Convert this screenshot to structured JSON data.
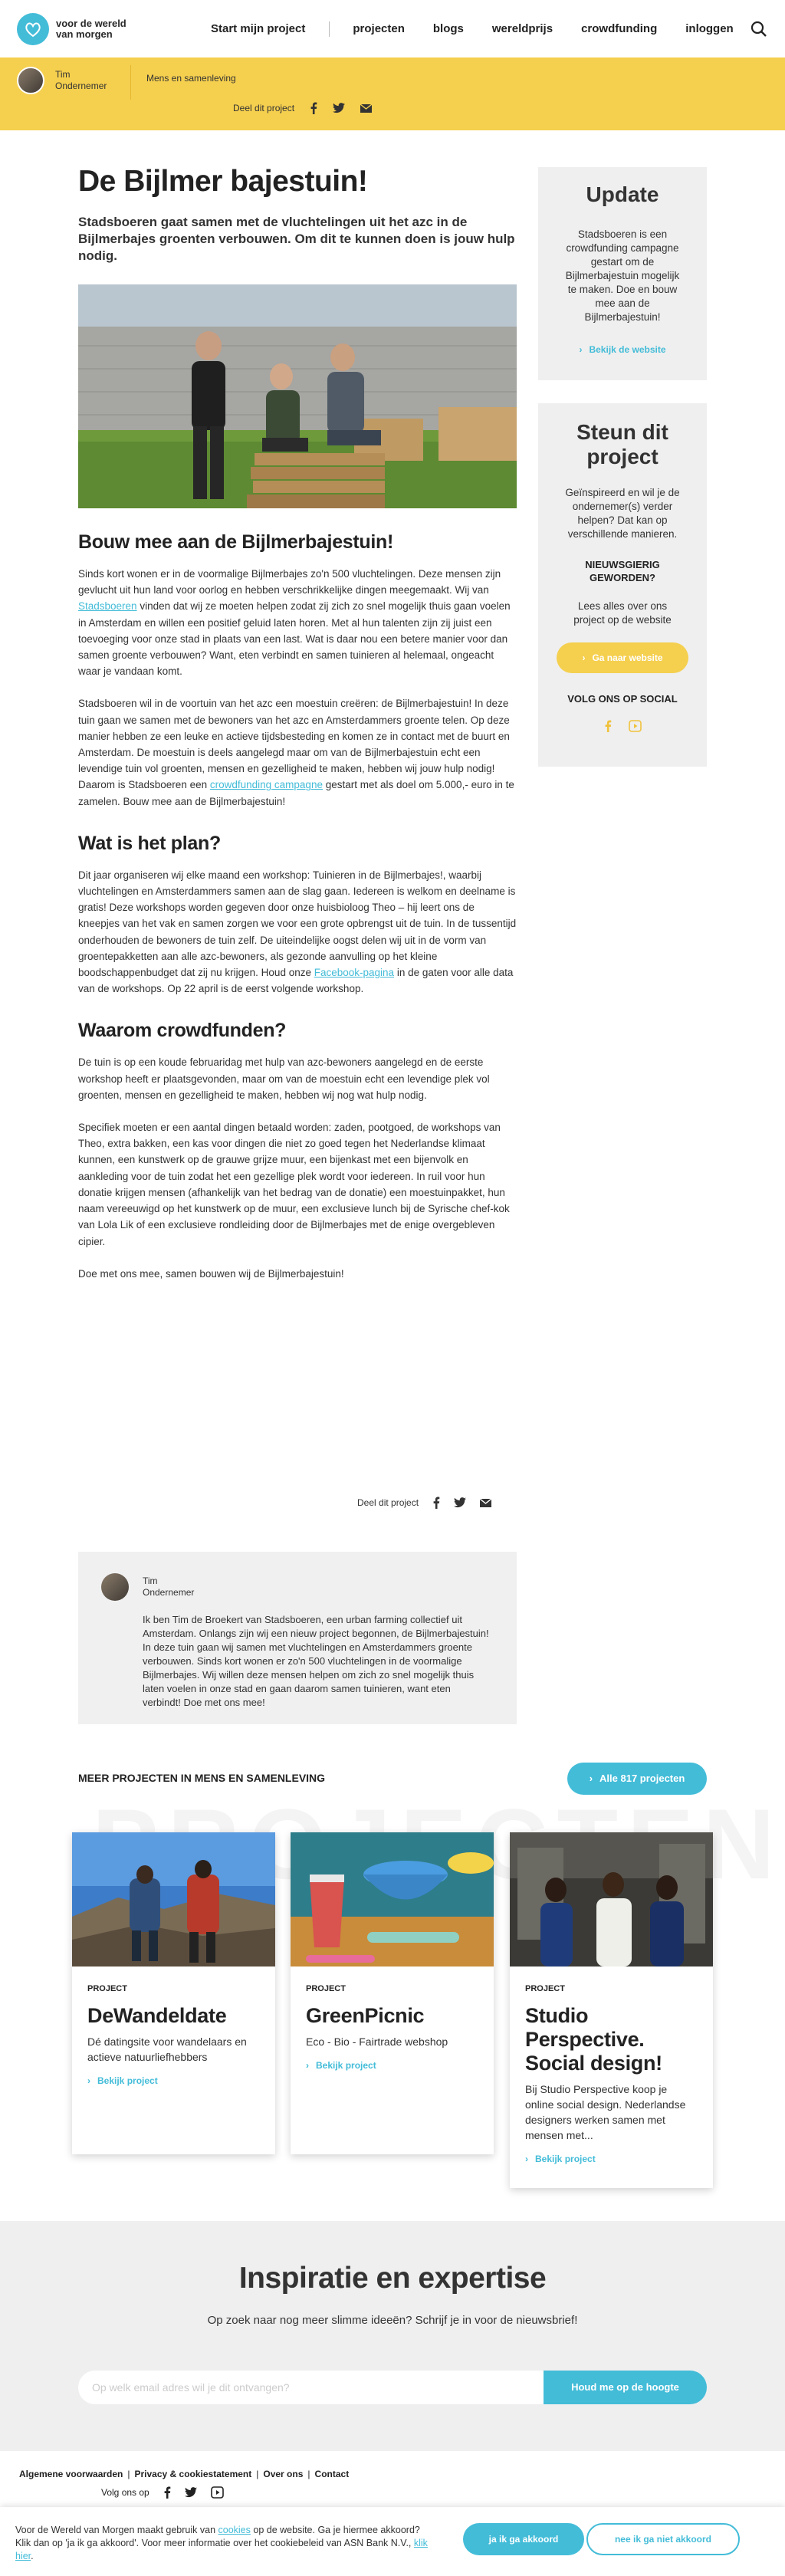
{
  "header": {
    "logo_text": "voor de wereld van morgen",
    "nav": [
      "Start mijn project",
      "projecten",
      "blogs",
      "wereldprijs",
      "crowdfunding",
      "inloggen"
    ]
  },
  "ybar": {
    "author_name": "Tim",
    "author_role": "Ondernemer",
    "category": "Mens en samenleving",
    "share_label": "Deel dit project"
  },
  "article": {
    "title": "De Bijlmer bajestuin!",
    "intro": "Stadsboeren gaat samen met de vluchtelingen uit het azc in de Bijlmerbajes groenten verbouwen. Om dit te kunnen doen is jouw hulp nodig.",
    "h_build": "Bouw mee aan de Bijlmerbajestuin!",
    "p1_a": "Sinds kort wonen er in de voormalige Bijlmerbajes zo'n 500 vluchtelingen. Deze mensen zijn gevlucht uit hun land voor oorlog en hebben verschrikkelijke dingen meegemaakt. Wij van ",
    "p1_link": "Stadsboeren",
    "p1_b": " vinden dat wij ze moeten helpen zodat zij zich zo snel mogelijk thuis gaan voelen in Amsterdam en willen een positief geluid laten horen. Met al hun talenten zijn zij juist een toevoeging voor onze stad in plaats van een last. Wat is daar nou een betere manier voor dan samen groente verbouwen? Want, eten verbindt en samen tuinieren al helemaal, ongeacht waar je vandaan komt.",
    "p2_a": "Stadsboeren wil in de voortuin van het azc een moestuin creëren: de Bijlmerbajestuin! In deze tuin gaan we samen met de bewoners van het azc en Amsterdammers groente telen. Op deze manier hebben ze een leuke en actieve tijdsbesteding en komen ze in contact met de buurt en Amsterdam. De moestuin is deels aangelegd maar om van de Bijlmerbajestuin echt een levendige tuin vol groenten, mensen en gezelligheid te maken, hebben wij jouw hulp nodig! Daarom is Stadsboeren een ",
    "p2_link": "crowdfunding campagne",
    "p2_b": " gestart met als doel om 5.000,- euro in te zamelen. Bouw mee aan de Bijlmerbajestuin!",
    "h_plan": "Wat is het plan?",
    "p3_a": "Dit jaar organiseren wij elke maand een workshop: Tuinieren in de Bijlmerbajes!, waarbij vluchtelingen en Amsterdammers samen aan de slag gaan. Iedereen is welkom en deelname is gratis! Deze workshops worden gegeven door onze huisbioloog Theo – hij leert ons de kneepjes van het vak en samen zorgen we voor een grote opbrengst uit de tuin. In de tussentijd onderhouden de bewoners de tuin zelf. De uiteindelijke oogst delen wij uit in de vorm van groentepakketten aan alle azc-bewoners, als gezonde aanvulling op het kleine boodschappenbudget dat zij nu krijgen. Houd onze ",
    "p3_link": "Facebook-pagina",
    "p3_b": " in de gaten voor alle data van de workshops. Op 22 april is de eerst volgende workshop.",
    "h_why": "Waarom crowdfunden?",
    "p4": "De tuin is op een koude februaridag met hulp van azc-bewoners aangelegd en de eerste workshop heeft er plaatsgevonden, maar om van de moestuin echt een levendige plek vol groenten, mensen en gezelligheid te maken, hebben wij nog wat hulp nodig.",
    "p5": "Specifiek moeten er een aantal dingen betaald worden: zaden, pootgoed, de workshops van Theo, extra bakken, een kas voor dingen die niet zo goed tegen het Nederlandse klimaat kunnen, een kunstwerk op de grauwe grijze muur, een bijenkast met een bijenvolk en aankleding voor de tuin zodat het een gezellige plek wordt voor iedereen. In ruil voor hun donatie krijgen mensen (afhankelijk van het bedrag van de donatie) een moestuinpakket, hun naam vereeuwigd op het kunstwerk op de muur, een exclusieve lunch bij de Syrische chef-kok van Lola Lik of een exclusieve rondleiding door de Bijlmerbajes met de enige overgebleven cipier.",
    "p6": "Doe met ons mee, samen bouwen wij de Bijlmerbajestuin!",
    "share_label": "Deel dit project"
  },
  "author_box": {
    "name": "Tim",
    "role": "Ondernemer",
    "text": "Ik ben Tim de Broekert van Stadsboeren, een urban farming collectief uit Amsterdam. Onlangs zijn wij een nieuw project begonnen, de Bijlmerbajestuin! In deze tuin gaan wij samen met vluchtelingen en Amsterdammers groente verbouwen. Sinds kort wonen er zo'n 500 vluchtelingen in de voormalige Bijlmerbajes. Wij willen deze mensen helpen om zich zo snel mogelijk thuis laten voelen in onze stad en gaan daarom samen tuinieren, want eten verbindt! Doe met ons mee!"
  },
  "sidebar": {
    "update_title": "Update",
    "update_text": "Stadsboeren is een crowdfunding campagne gestart om de Bijlmerbajestuin mogelijk te maken. Doe en bouw mee aan de Bijlmerbajestuin!",
    "update_link": "Bekijk de website",
    "support_title": "Steun dit project",
    "support_text": "Geïnspireerd en wil je de ondernemer(s) verder helpen? Dat kan op verschillende manieren.",
    "curious_title": "NIEUWSGIERIG GEWORDEN?",
    "curious_text": "Lees alles over ons project op de website",
    "website_btn": "Ga naar website",
    "social_title": "VOLG ONS OP SOCIAL"
  },
  "more": {
    "heading": "MEER PROJECTEN IN MENS EN SAMENLEVING",
    "all_btn": "Alle 817 projecten",
    "bg_word": "PROJECTEN",
    "cards": [
      {
        "label": "PROJECT",
        "title": "DeWandeldate",
        "desc": "Dé datingsite voor wandelaars en actieve natuurliefhebbers",
        "link": "Bekijk project"
      },
      {
        "label": "PROJECT",
        "title": "GreenPicnic",
        "desc": "Eco - Bio - Fairtrade webshop",
        "link": "Bekijk project"
      },
      {
        "label": "PROJECT",
        "title": "Studio Perspective. Social design!",
        "desc": "Bij Studio Perspective koop je online social design. Nederlandse designers werken samen met mensen met...",
        "link": "Bekijk project"
      }
    ]
  },
  "inspiratie": {
    "title": "Inspiratie en expertise",
    "subtitle": "Op zoek naar nog meer slimme ideeën? Schrijf je in voor de nieuwsbrief!",
    "placeholder": "Op welk email adres wil je dit ontvangen?",
    "button": "Houd me op de hoogte"
  },
  "footer": {
    "links": [
      "Algemene voorwaarden",
      "Privacy & cookiestatement",
      "Over ons",
      "Contact"
    ],
    "follow": "Volg ons op"
  },
  "cookie": {
    "text_a": "Voor de Wereld van Morgen maakt gebruik van ",
    "link1": "cookies",
    "text_b": " op de website. Ga je hiermee akkoord? Klik dan op 'ja ik ga akkoord'. Voor meer informatie over het cookiebeleid van ASN Bank N.V., ",
    "link2": "klik hier",
    "text_c": ".",
    "accept": "ja ik ga akkoord",
    "decline": "nee ik ga niet akkoord"
  },
  "colors": {
    "accent": "#43bcd8",
    "yellow": "#f5cf4e",
    "panel": "#efefef"
  }
}
